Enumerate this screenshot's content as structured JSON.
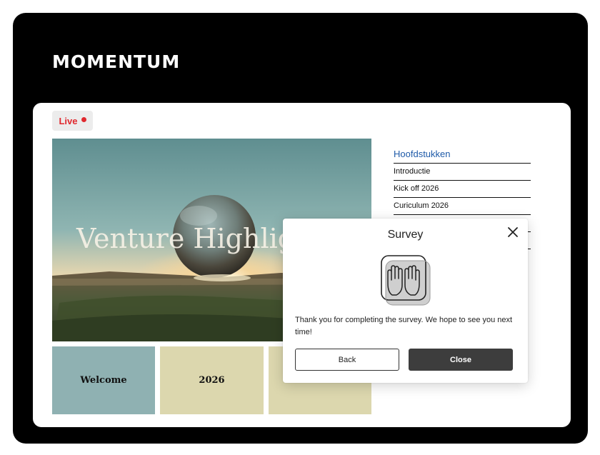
{
  "brand": {
    "name": "MOMENTUM"
  },
  "status": {
    "live_label": "Live",
    "live_color": "#e0282e"
  },
  "hero": {
    "title": "Venture Highligh"
  },
  "tiles": [
    {
      "label": "Welcome",
      "color": "#8fb1b2"
    },
    {
      "label": "2026",
      "color": "#dcd7ae"
    },
    {
      "label": "",
      "color": "#dcd7ae"
    }
  ],
  "chapters": {
    "title": "Hoofdstukken",
    "items": [
      "Introductie",
      "Kick off 2026",
      "Curiculum 2026"
    ]
  },
  "dialog": {
    "title": "Survey",
    "icon": "raised-hands-icon",
    "message": "Thank you for completing the survey. We hope to see you next time!",
    "back_label": "Back",
    "close_label": "Close"
  },
  "colors": {
    "frame": "#000000",
    "accent_link": "#1e5aa8",
    "primary_button": "#3d3d3d"
  }
}
